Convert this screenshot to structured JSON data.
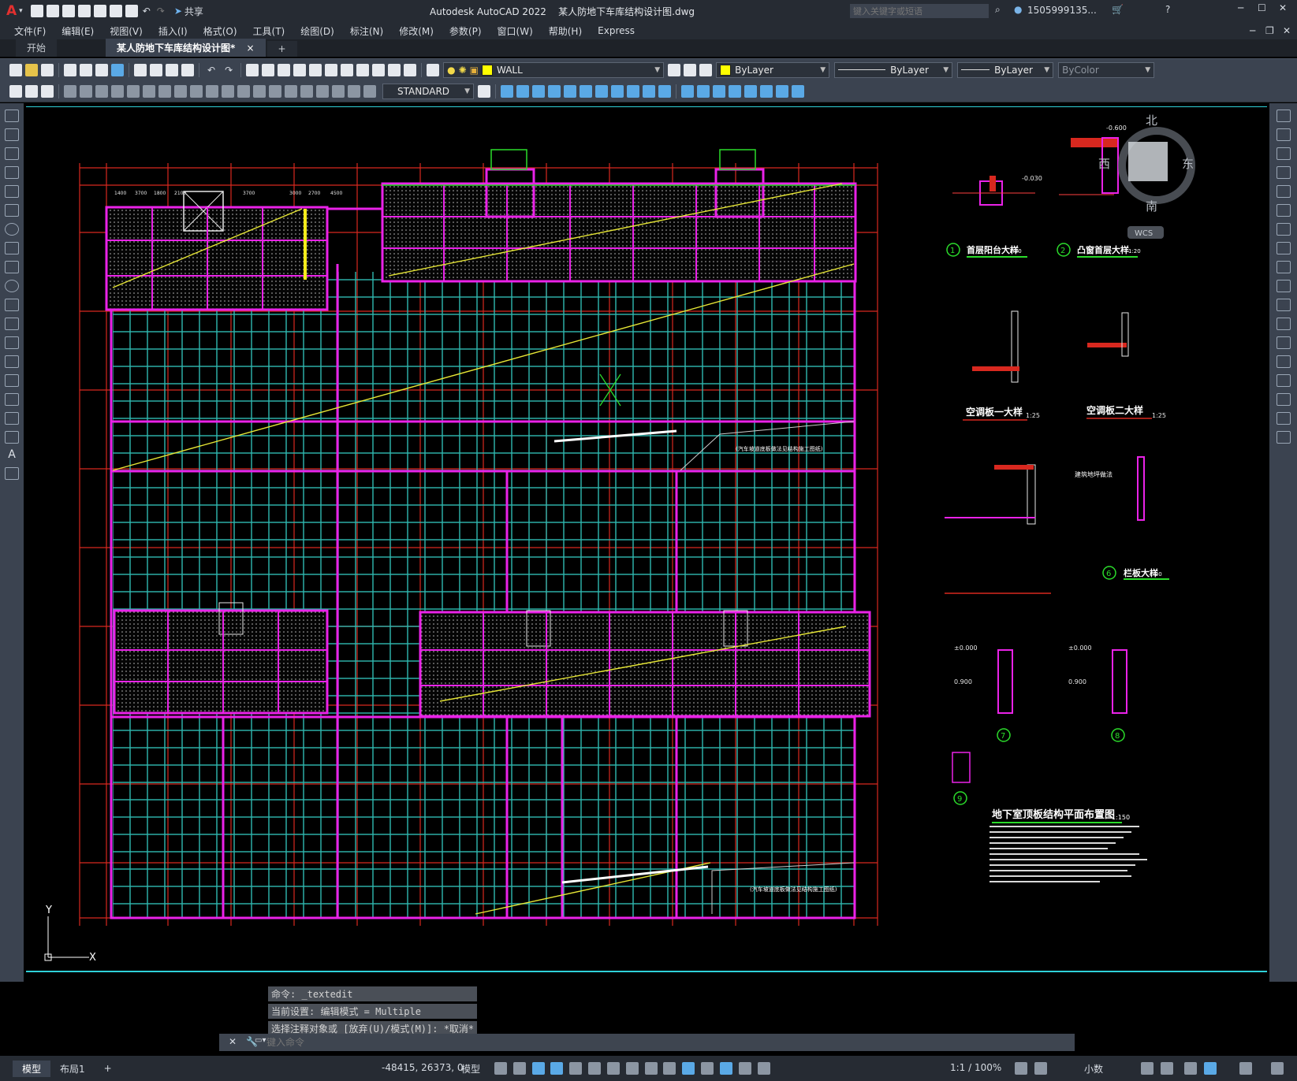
{
  "app": {
    "title": "Autodesk AutoCAD 2022    某人防地下车库结构设计图.dwg",
    "search_placeholder": "键入关键字或短语",
    "user": "1505999135...",
    "share_label": "共享"
  },
  "menu": [
    "文件(F)",
    "编辑(E)",
    "视图(V)",
    "插入(I)",
    "格式(O)",
    "工具(T)",
    "绘图(D)",
    "标注(N)",
    "修改(M)",
    "参数(P)",
    "窗口(W)",
    "帮助(H)",
    "Express"
  ],
  "tabs": {
    "start": "开始",
    "active": "某人防地下车库结构设计图*",
    "close": "×",
    "new": "+"
  },
  "toolbar": {
    "layer": "WALL",
    "color": "ByLayer",
    "linetype": "ByLayer",
    "lineweight": "ByLayer",
    "plotstyle": "ByColor",
    "textstyle": "STANDARD"
  },
  "viewcube": {
    "north": "北",
    "south": "南",
    "east": "东",
    "west": "西",
    "wcs": "WCS"
  },
  "drawing": {
    "labels": {
      "balcony": "首层阳台大样",
      "balcony_scale": "1:20",
      "bay_window": "凸窗首层大样",
      "bay_scale": "1:20",
      "ac1": "空调板一大样",
      "ac1_scale": "1:25",
      "ac2": "空调板二大样",
      "ac2_scale": "1:25",
      "railing": "栏板大样",
      "railing_scale": "1:20",
      "plan_title": "地下室顶板结构平面布置图",
      "plan_scale": "1:150",
      "n1": "1",
      "n2": "2",
      "n6": "6",
      "n7": "7",
      "n8": "8",
      "n9": "9",
      "d1": "-0.030",
      "d2": "-0.600",
      "d3": "±0.000",
      "d4": "±0.000",
      "d5": "0.900",
      "d6": "0.900",
      "build_slope": "建筑地坪做法",
      "ramp1": "(汽车坡道底板做法见结构施工图纸)",
      "ramp2": "(汽车坡道底板做法见结构施工图纸)",
      "dims": [
        "1400",
        "3700",
        "1800",
        "2100",
        "3700",
        "3000",
        "2700",
        "4500"
      ]
    }
  },
  "ucs": {
    "y": "Y",
    "x": "X"
  },
  "command": {
    "history": [
      "命令: _textedit",
      "当前设置: 编辑模式 = Multiple",
      "选择注释对象或 [放弃(U)/模式(M)]: *取消*"
    ],
    "placeholder": "键入命令"
  },
  "status": {
    "model_tab": "模型",
    "layout_tab": "布局1",
    "add": "+",
    "coords": "-48415, 26373, 0",
    "model": "模型",
    "scale": "1:1 / 100%",
    "units": "小数"
  }
}
